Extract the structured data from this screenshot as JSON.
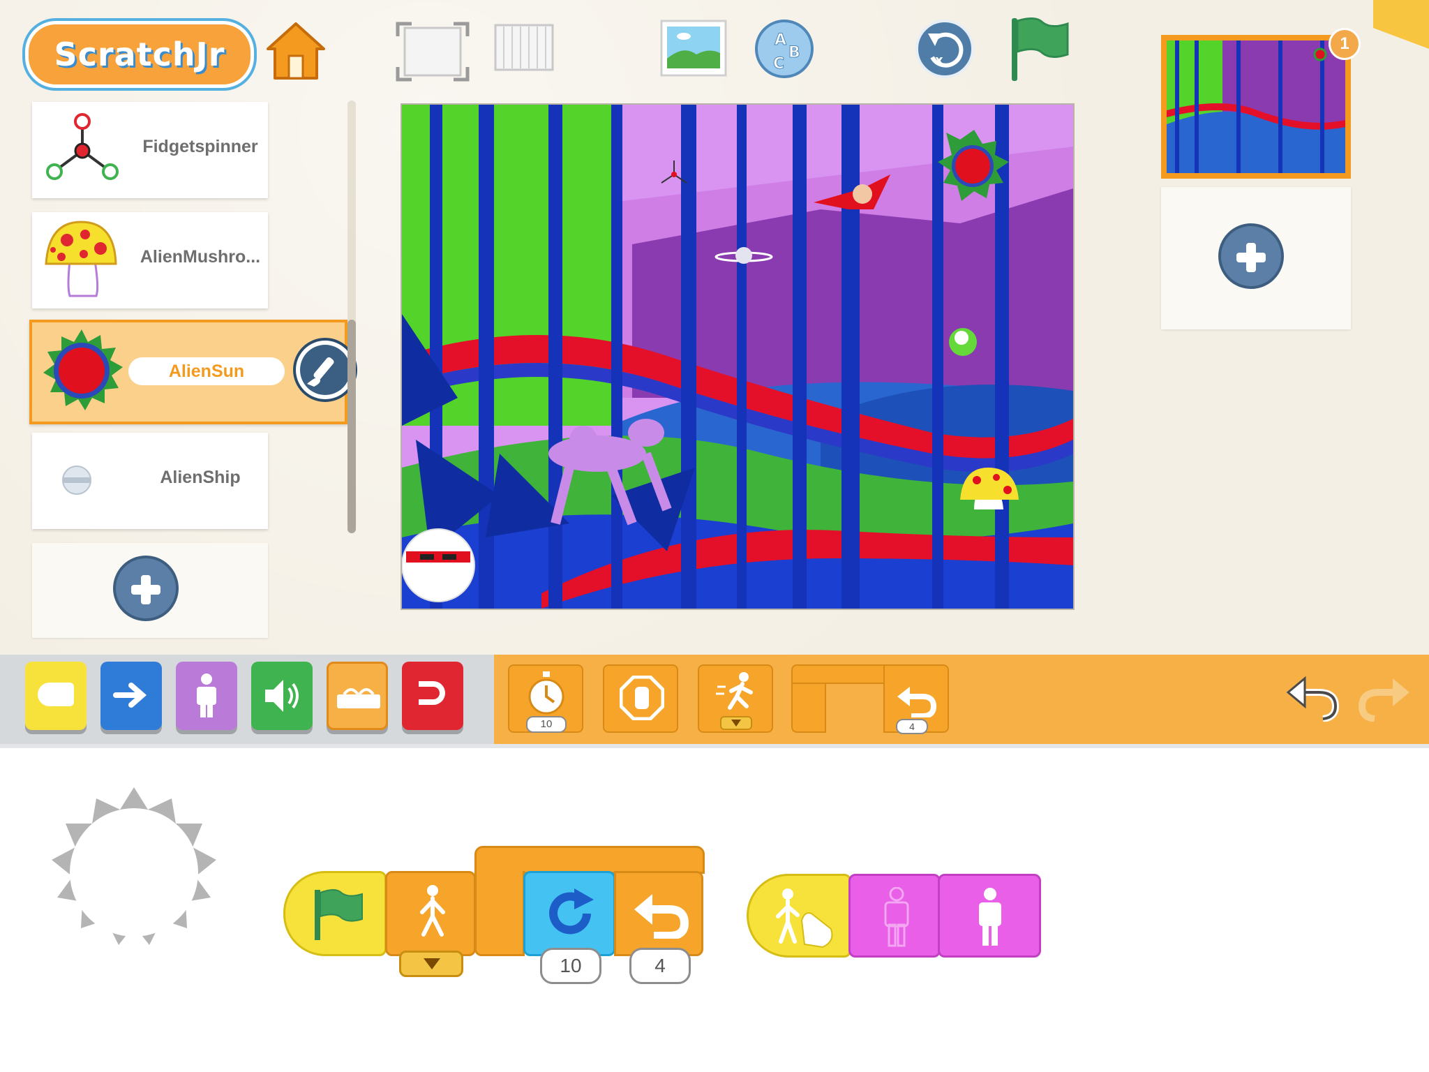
{
  "app": {
    "logo_text": "ScratchJr"
  },
  "toolbar": {
    "home_icon": "home-icon",
    "fullscreen_icon": "fullscreen-icon",
    "grid_icon": "grid-icon",
    "background_icon": "background-picture-icon",
    "text_icon": "text-abc-icon",
    "reset_icon": "reset-characters-icon",
    "green_flag_icon": "green-flag-icon"
  },
  "sprites": [
    {
      "name": "Fidgetspinner"
    },
    {
      "name": "AlienMushro..."
    },
    {
      "name": "AlienSun",
      "selected": true
    },
    {
      "name": "AlienShip"
    }
  ],
  "pages": {
    "count_badge": "1"
  },
  "palette": {
    "categories": [
      "triggering",
      "motion",
      "looks",
      "sound",
      "control",
      "end"
    ],
    "control_blocks": [
      {
        "name": "wait",
        "value": "10"
      },
      {
        "name": "stop",
        "value": ""
      },
      {
        "name": "set-speed",
        "value": ""
      },
      {
        "name": "repeat",
        "value": "4"
      }
    ]
  },
  "script_area": {
    "script1": {
      "repeat_count": "10",
      "repeat_inner": "4"
    }
  },
  "colors": {
    "accent_orange": "#f39a1f",
    "control_orange": "#f6b046",
    "trigger_yellow": "#f6e23a",
    "motion_blue": "#2f7bd8",
    "looks_purple": "#b97ad8",
    "sound_green": "#3fb34f",
    "end_red": "#e02630"
  }
}
